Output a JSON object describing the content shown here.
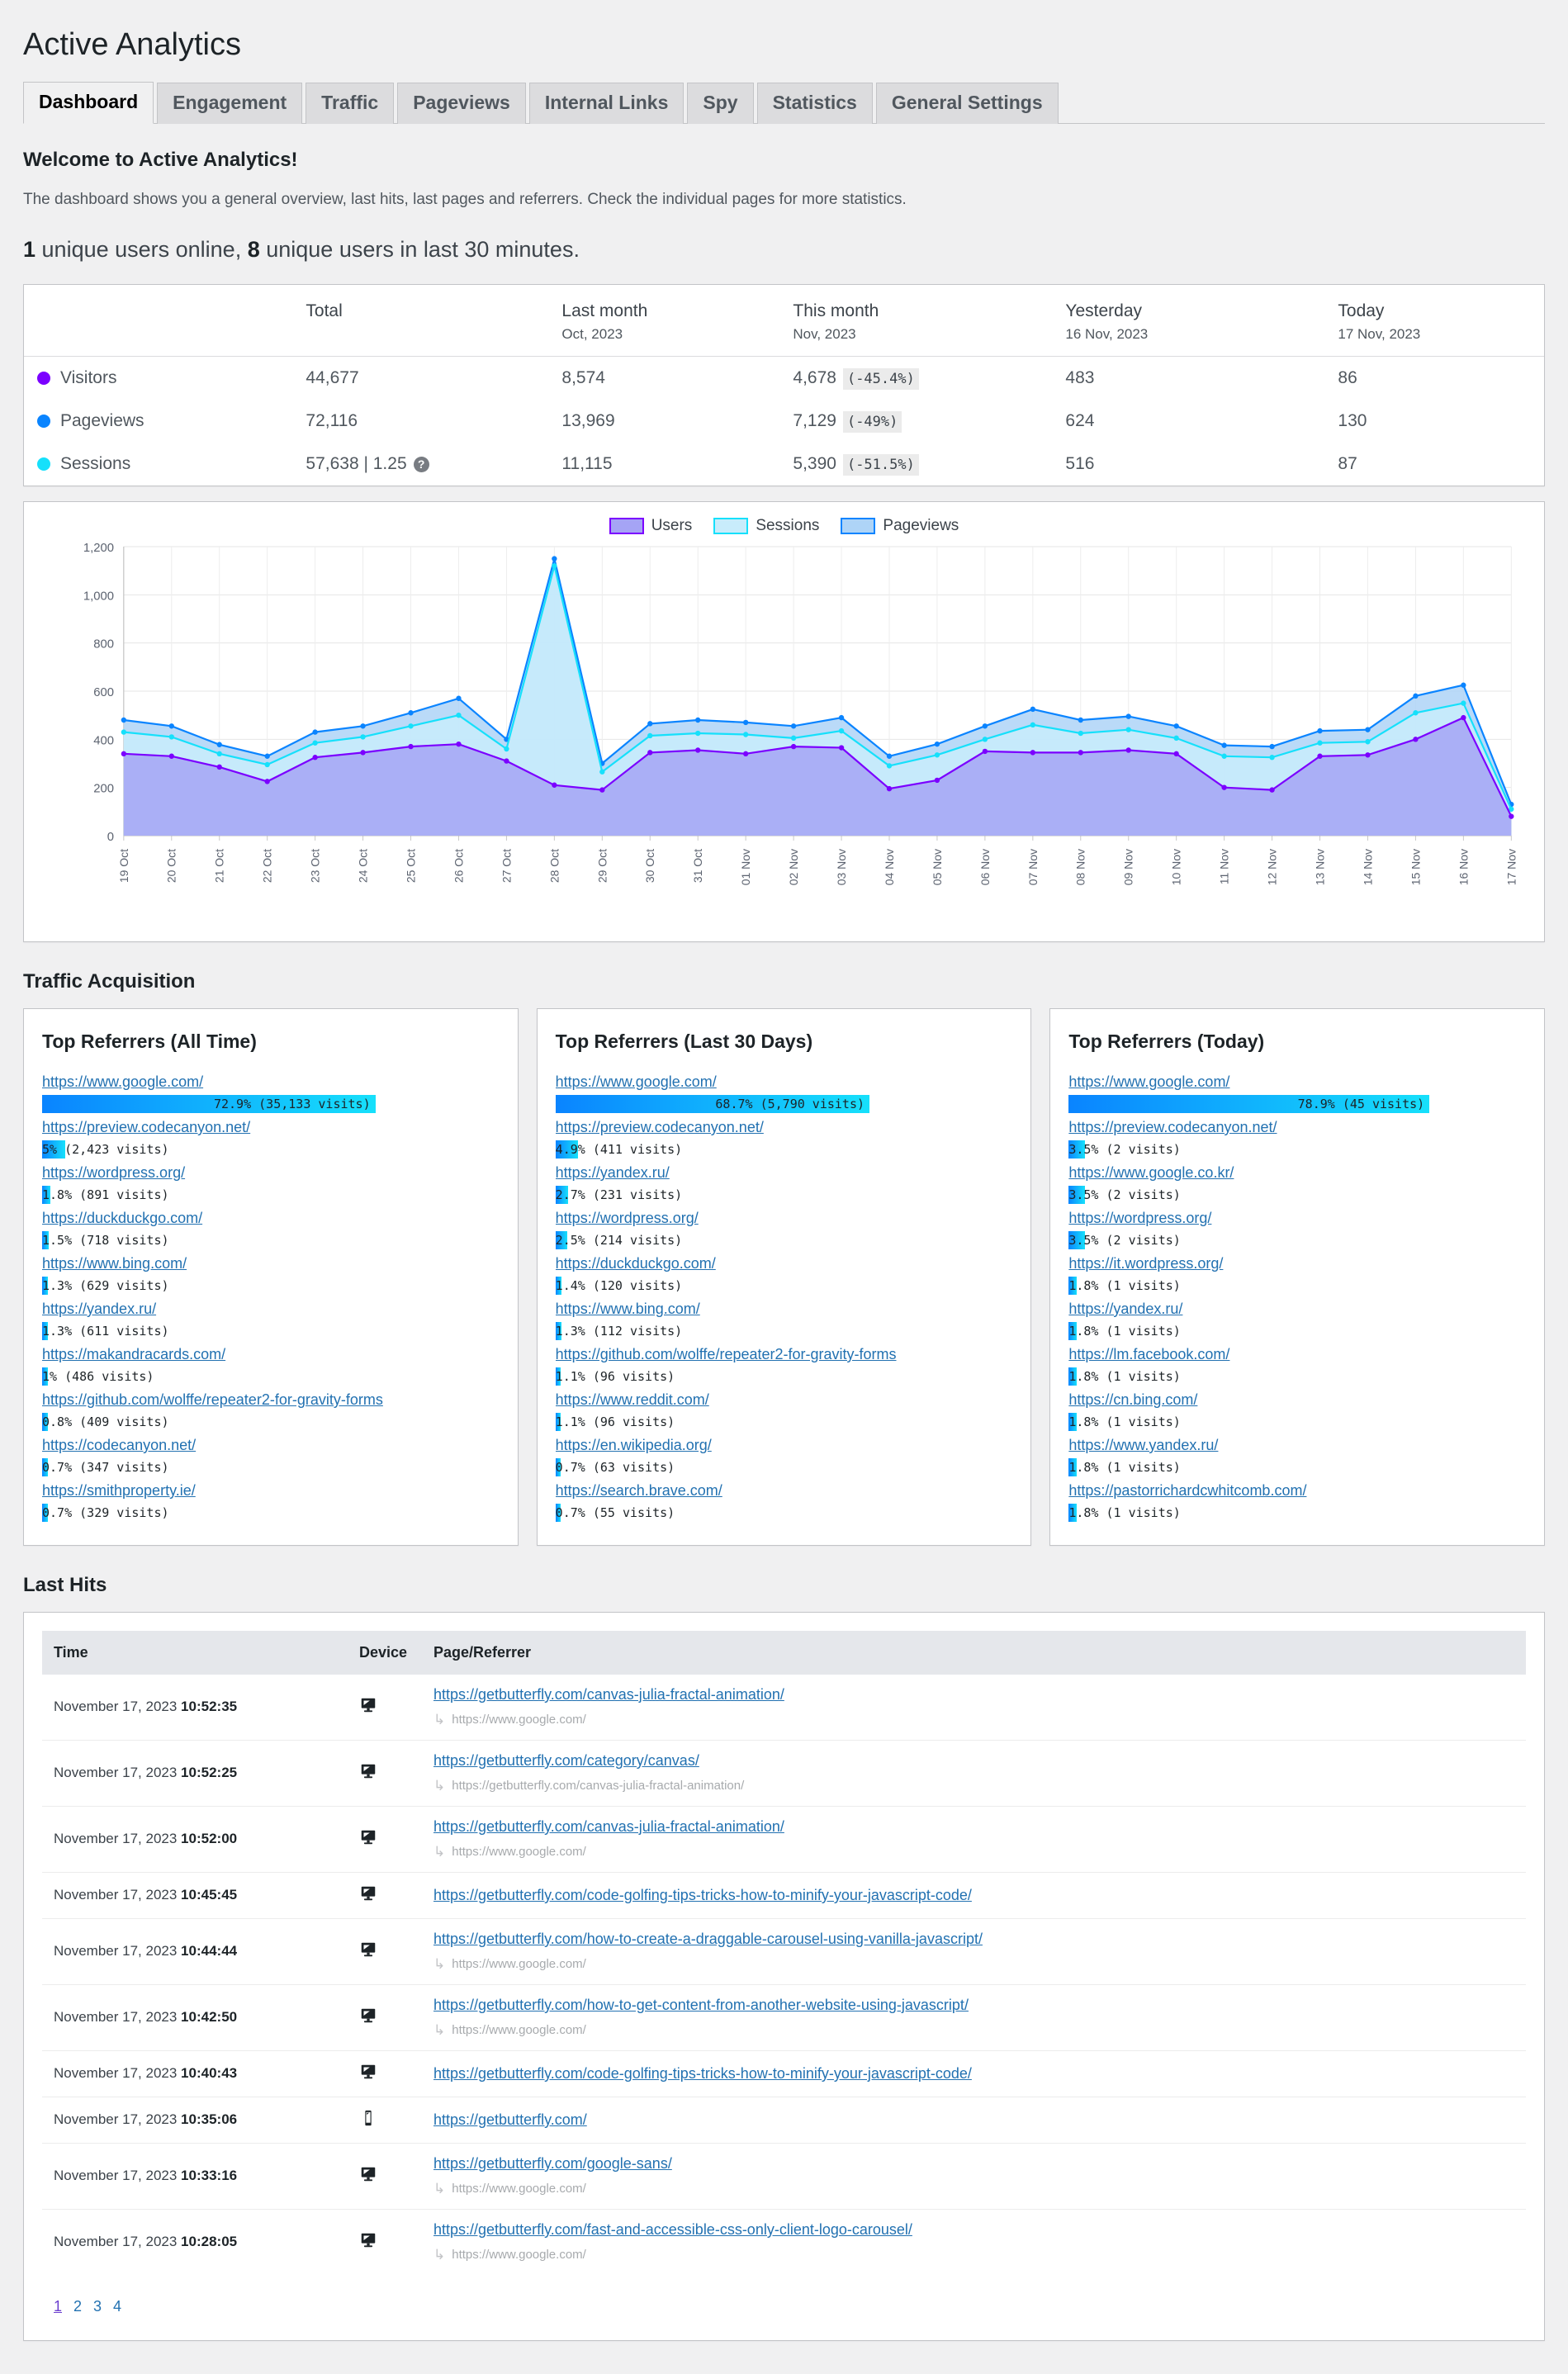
{
  "header": {
    "title": "Active Analytics",
    "tabs": [
      {
        "label": "Dashboard",
        "active": true
      },
      {
        "label": "Engagement",
        "active": false
      },
      {
        "label": "Traffic",
        "active": false
      },
      {
        "label": "Pageviews",
        "active": false
      },
      {
        "label": "Internal Links",
        "active": false
      },
      {
        "label": "Spy",
        "active": false
      },
      {
        "label": "Statistics",
        "active": false
      },
      {
        "label": "General Settings",
        "active": false
      }
    ]
  },
  "intro": {
    "heading": "Welcome to Active Analytics!",
    "description": "The dashboard shows you a general overview, last hits, last pages and referrers. Check the individual pages for more statistics.",
    "online_prefix": "1",
    "online_mid": " unique users online, ",
    "online_count": "8",
    "online_suffix": " unique users in last 30 minutes."
  },
  "summary": {
    "columns": [
      {
        "main": "",
        "sub": ""
      },
      {
        "main": "Total",
        "sub": ""
      },
      {
        "main": "Last month",
        "sub": "Oct, 2023"
      },
      {
        "main": "This month",
        "sub": "Nov, 2023"
      },
      {
        "main": "Yesterday",
        "sub": "16 Nov, 2023"
      },
      {
        "main": "Today",
        "sub": "17 Nov, 2023"
      }
    ],
    "rows": [
      {
        "label": "Visitors",
        "color": "#7b00ff",
        "total": "44,677",
        "last_month": "8,574",
        "this_month": "4,678",
        "this_month_pct": "(-45.4%)",
        "yesterday": "483",
        "today": "86",
        "has_help": false
      },
      {
        "label": "Pageviews",
        "color": "#0a84ff",
        "total": "72,116",
        "last_month": "13,969",
        "this_month": "7,129",
        "this_month_pct": "(-49%)",
        "yesterday": "624",
        "today": "130",
        "has_help": false
      },
      {
        "label": "Sessions",
        "color": "#16e0fb",
        "total": "57,638 | 1.25",
        "last_month": "11,115",
        "this_month": "5,390",
        "this_month_pct": "(-51.5%)",
        "yesterday": "516",
        "today": "87",
        "has_help": true,
        "help_glyph": "?"
      }
    ]
  },
  "chart_data": {
    "type": "area",
    "title": "",
    "xlabel": "",
    "ylabel": "",
    "ylim": [
      0,
      1200
    ],
    "yticks": [
      0,
      200,
      400,
      600,
      800,
      1000,
      1200
    ],
    "ytick_labels": [
      "0",
      "200",
      "400",
      "600",
      "800",
      "1,000",
      "1,200"
    ],
    "grid": true,
    "legend_position": "top-right",
    "categories": [
      "19 Oct",
      "20 Oct",
      "21 Oct",
      "22 Oct",
      "23 Oct",
      "24 Oct",
      "25 Oct",
      "26 Oct",
      "27 Oct",
      "28 Oct",
      "29 Oct",
      "30 Oct",
      "31 Oct",
      "01 Nov",
      "02 Nov",
      "03 Nov",
      "04 Nov",
      "05 Nov",
      "06 Nov",
      "07 Nov",
      "08 Nov",
      "09 Nov",
      "10 Nov",
      "11 Nov",
      "12 Nov",
      "13 Nov",
      "14 Nov",
      "15 Nov",
      "16 Nov",
      "17 Nov"
    ],
    "series": [
      {
        "name": "Pageviews",
        "color": "#0a84ff",
        "fill": "#aed4f7",
        "values": [
          480,
          455,
          378,
          330,
          430,
          455,
          510,
          570,
          400,
          1150,
          300,
          465,
          480,
          470,
          455,
          490,
          330,
          380,
          455,
          525,
          480,
          495,
          455,
          375,
          370,
          435,
          440,
          580,
          625,
          130
        ]
      },
      {
        "name": "Sessions",
        "color": "#16e0fb",
        "fill": "#c8ecfb",
        "values": [
          430,
          410,
          340,
          295,
          385,
          410,
          455,
          500,
          360,
          1120,
          265,
          415,
          425,
          420,
          405,
          435,
          290,
          335,
          400,
          460,
          425,
          440,
          405,
          330,
          325,
          385,
          390,
          510,
          550,
          110
        ]
      },
      {
        "name": "Users",
        "color": "#7b00ff",
        "fill": "#a5a4f5",
        "values": [
          340,
          330,
          285,
          225,
          325,
          345,
          370,
          380,
          310,
          210,
          190,
          345,
          355,
          340,
          370,
          365,
          195,
          230,
          350,
          345,
          345,
          355,
          340,
          200,
          190,
          330,
          335,
          400,
          490,
          80
        ]
      }
    ]
  },
  "traffic_acquisition": {
    "section_title": "Traffic Acquisition",
    "cards": [
      {
        "title": "Top Referrers (All Time)",
        "items": [
          {
            "url": "https://www.google.com/",
            "pct": 72.9,
            "label": "72.9% (35,133 visits)",
            "label_inside": true
          },
          {
            "url": "https://preview.codecanyon.net/",
            "pct": 5,
            "label": "5% (2,423 visits)",
            "label_inside": false
          },
          {
            "url": "https://wordpress.org/",
            "pct": 1.8,
            "label": "1.8% (891 visits)",
            "label_inside": false
          },
          {
            "url": "https://duckduckgo.com/",
            "pct": 1.5,
            "label": "1.5% (718 visits)",
            "label_inside": false
          },
          {
            "url": "https://www.bing.com/",
            "pct": 1.3,
            "label": "1.3% (629 visits)",
            "label_inside": false
          },
          {
            "url": "https://yandex.ru/",
            "pct": 1.3,
            "label": "1.3% (611 visits)",
            "label_inside": false
          },
          {
            "url": "https://makandracards.com/",
            "pct": 1,
            "label": "1% (486 visits)",
            "label_inside": false
          },
          {
            "url": "https://github.com/wolffe/repeater2-for-gravity-forms",
            "pct": 0.8,
            "label": "0.8% (409 visits)",
            "label_inside": false
          },
          {
            "url": "https://codecanyon.net/",
            "pct": 0.7,
            "label": "0.7% (347 visits)",
            "label_inside": false
          },
          {
            "url": "https://smithproperty.ie/",
            "pct": 0.7,
            "label": "0.7% (329 visits)",
            "label_inside": false
          }
        ]
      },
      {
        "title": "Top Referrers (Last 30 Days)",
        "items": [
          {
            "url": "https://www.google.com/",
            "pct": 68.7,
            "label": "68.7% (5,790 visits)",
            "label_inside": true
          },
          {
            "url": "https://preview.codecanyon.net/",
            "pct": 4.9,
            "label": "4.9% (411 visits)",
            "label_inside": false
          },
          {
            "url": "https://yandex.ru/",
            "pct": 2.7,
            "label": "2.7% (231 visits)",
            "label_inside": false
          },
          {
            "url": "https://wordpress.org/",
            "pct": 2.5,
            "label": "2.5% (214 visits)",
            "label_inside": false
          },
          {
            "url": "https://duckduckgo.com/",
            "pct": 1.4,
            "label": "1.4% (120 visits)",
            "label_inside": false
          },
          {
            "url": "https://www.bing.com/",
            "pct": 1.3,
            "label": "1.3% (112 visits)",
            "label_inside": false
          },
          {
            "url": "https://github.com/wolffe/repeater2-for-gravity-forms",
            "pct": 1.1,
            "label": "1.1% (96 visits)",
            "label_inside": false
          },
          {
            "url": "https://www.reddit.com/",
            "pct": 1.1,
            "label": "1.1% (96 visits)",
            "label_inside": false
          },
          {
            "url": "https://en.wikipedia.org/",
            "pct": 0.7,
            "label": "0.7% (63 visits)",
            "label_inside": false
          },
          {
            "url": "https://search.brave.com/",
            "pct": 0.7,
            "label": "0.7% (55 visits)",
            "label_inside": false
          }
        ]
      },
      {
        "title": "Top Referrers (Today)",
        "items": [
          {
            "url": "https://www.google.com/",
            "pct": 78.9,
            "label": "78.9% (45 visits)",
            "label_inside": true
          },
          {
            "url": "https://preview.codecanyon.net/",
            "pct": 3.5,
            "label": "3.5% (2 visits)",
            "label_inside": false
          },
          {
            "url": "https://www.google.co.kr/",
            "pct": 3.5,
            "label": "3.5% (2 visits)",
            "label_inside": false
          },
          {
            "url": "https://wordpress.org/",
            "pct": 3.5,
            "label": "3.5% (2 visits)",
            "label_inside": false
          },
          {
            "url": "https://it.wordpress.org/",
            "pct": 1.8,
            "label": "1.8% (1 visits)",
            "label_inside": false
          },
          {
            "url": "https://yandex.ru/",
            "pct": 1.8,
            "label": "1.8% (1 visits)",
            "label_inside": false
          },
          {
            "url": "https://lm.facebook.com/",
            "pct": 1.8,
            "label": "1.8% (1 visits)",
            "label_inside": false
          },
          {
            "url": "https://cn.bing.com/",
            "pct": 1.8,
            "label": "1.8% (1 visits)",
            "label_inside": false
          },
          {
            "url": "https://www.yandex.ru/",
            "pct": 1.8,
            "label": "1.8% (1 visits)",
            "label_inside": false
          },
          {
            "url": "https://pastorrichardcwhitcomb.com/",
            "pct": 1.8,
            "label": "1.8% (1 visits)",
            "label_inside": false
          }
        ]
      }
    ]
  },
  "last_hits": {
    "section_title": "Last Hits",
    "columns": [
      "Time",
      "Device",
      "Page/Referrer"
    ],
    "rows": [
      {
        "date": "November 17, 2023 ",
        "time": "10:52:35",
        "device": "desktop",
        "page": "https://getbutterfly.com/canvas-julia-fractal-animation/",
        "referrer": "https://www.google.com/"
      },
      {
        "date": "November 17, 2023 ",
        "time": "10:52:25",
        "device": "desktop",
        "page": "https://getbutterfly.com/category/canvas/",
        "referrer": "https://getbutterfly.com/canvas-julia-fractal-animation/"
      },
      {
        "date": "November 17, 2023 ",
        "time": "10:52:00",
        "device": "desktop",
        "page": "https://getbutterfly.com/canvas-julia-fractal-animation/",
        "referrer": "https://www.google.com/"
      },
      {
        "date": "November 17, 2023 ",
        "time": "10:45:45",
        "device": "desktop",
        "page": "https://getbutterfly.com/code-golfing-tips-tricks-how-to-minify-your-javascript-code/",
        "referrer": ""
      },
      {
        "date": "November 17, 2023 ",
        "time": "10:44:44",
        "device": "desktop",
        "page": "https://getbutterfly.com/how-to-create-a-draggable-carousel-using-vanilla-javascript/",
        "referrer": "https://www.google.com/"
      },
      {
        "date": "November 17, 2023 ",
        "time": "10:42:50",
        "device": "desktop",
        "page": "https://getbutterfly.com/how-to-get-content-from-another-website-using-javascript/",
        "referrer": "https://www.google.com/"
      },
      {
        "date": "November 17, 2023 ",
        "time": "10:40:43",
        "device": "desktop",
        "page": "https://getbutterfly.com/code-golfing-tips-tricks-how-to-minify-your-javascript-code/",
        "referrer": ""
      },
      {
        "date": "November 17, 2023 ",
        "time": "10:35:06",
        "device": "mobile",
        "page": "https://getbutterfly.com/",
        "referrer": ""
      },
      {
        "date": "November 17, 2023 ",
        "time": "10:33:16",
        "device": "desktop",
        "page": "https://getbutterfly.com/google-sans/",
        "referrer": "https://www.google.com/"
      },
      {
        "date": "November 17, 2023 ",
        "time": "10:28:05",
        "device": "desktop",
        "page": "https://getbutterfly.com/fast-and-accessible-css-only-client-logo-carousel/",
        "referrer": "https://www.google.com/"
      }
    ],
    "pagination": [
      {
        "label": "1",
        "current": true
      },
      {
        "label": "2",
        "current": false
      },
      {
        "label": "3",
        "current": false
      },
      {
        "label": "4",
        "current": false
      }
    ]
  }
}
